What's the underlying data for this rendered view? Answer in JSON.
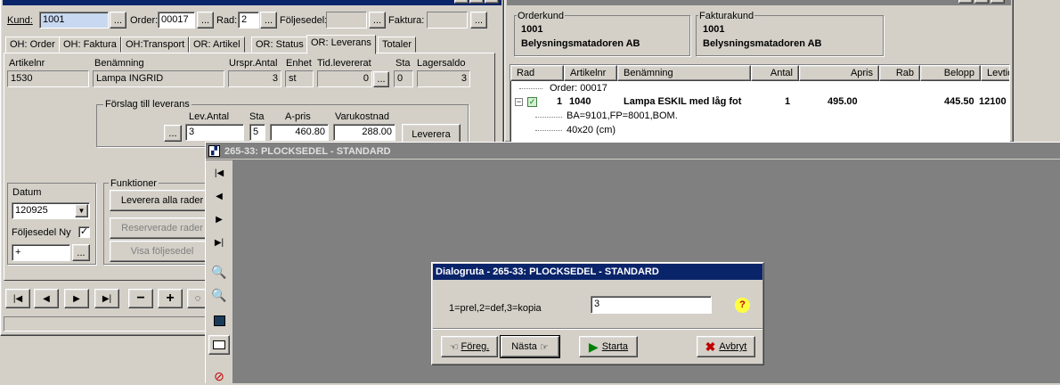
{
  "left": {
    "kund_label": "Kund:",
    "kund_value": "1001",
    "order_label": "Order:",
    "order_value": "00017",
    "rad_label": "Rad:",
    "rad_value": "2",
    "foljesedel_label": "Följesedel:",
    "faktura_label": "Faktura:",
    "browse": "...",
    "tabs": [
      "OH: Order",
      "OH: Faktura",
      "OH:Transport",
      "OR: Artikel",
      "OR: Status",
      "OR: Leverans",
      "Totaler"
    ],
    "active_tab": "OR: Leverans",
    "headers": {
      "artikelnr": "Artikelnr",
      "benamning": "Benämning",
      "urspr": "Urspr.Antal",
      "enhet": "Enhet",
      "tid": "Tid.levererat",
      "sta": "Sta",
      "lager": "Lagersaldo"
    },
    "row": {
      "artikelnr": "1530",
      "benamning": "Lampa INGRID",
      "urspr": "3",
      "enhet": "st",
      "tid": "0",
      "sta": "0",
      "lager": "3"
    },
    "forslag": {
      "title": "Förslag till leverans",
      "lev_antal_label": "Lev.Antal",
      "sta_label": "Sta",
      "apris_label": "A-pris",
      "varukostnad_label": "Varukostnad",
      "lev_antal": "3",
      "sta": "5",
      "apris": "460.80",
      "varukostnad": "288.00",
      "leverera": "Leverera"
    },
    "datum_label": "Datum",
    "datum_value": "120925",
    "foljesedel_ny_label": "Följesedel Ny",
    "plus_value": "+",
    "funktioner": {
      "title": "Funktioner",
      "leverera_alla": "Leverera alla rader",
      "reserverade": "Reserverade rader",
      "visa_foljesedel": "Visa följesedel"
    }
  },
  "right": {
    "orderkund": {
      "title": "Orderkund",
      "nr": "1001",
      "name": "Belysningsmatadoren AB"
    },
    "fakturakund": {
      "title": "Fakturakund",
      "nr": "1001",
      "name": "Belysningsmatadoren AB"
    },
    "columns": [
      "Rad",
      "Artikelnr",
      "Benämning",
      "Antal",
      "Apris",
      "Rab",
      "Belopp",
      "Levtid"
    ],
    "order_node": "Order: 00017",
    "line": {
      "rad": "1",
      "artikelnr": "1040",
      "benamning": "Lampa ESKIL med låg fot",
      "antal": "1",
      "apris": "495.00",
      "belopp": "445.50",
      "levtid": "12100"
    },
    "sub1": "BA=9101,FP=8001,BOM.",
    "sub2": "40x20 (cm)"
  },
  "report": {
    "title": "265-33: PLOCKSEDEL - STANDARD"
  },
  "dialog": {
    "title": "Dialogruta - 265-33: PLOCKSEDEL - STANDARD",
    "prompt": "1=prel,2=def,3=kopia",
    "value": "3",
    "foreg": "Föreg.",
    "nasta": "Nästa",
    "starta": "Starta",
    "avbryt": "Avbryt"
  },
  "colors": {
    "title_active": "#0a246a",
    "workspace": "#808080",
    "highlight": "#c8d8f0"
  }
}
